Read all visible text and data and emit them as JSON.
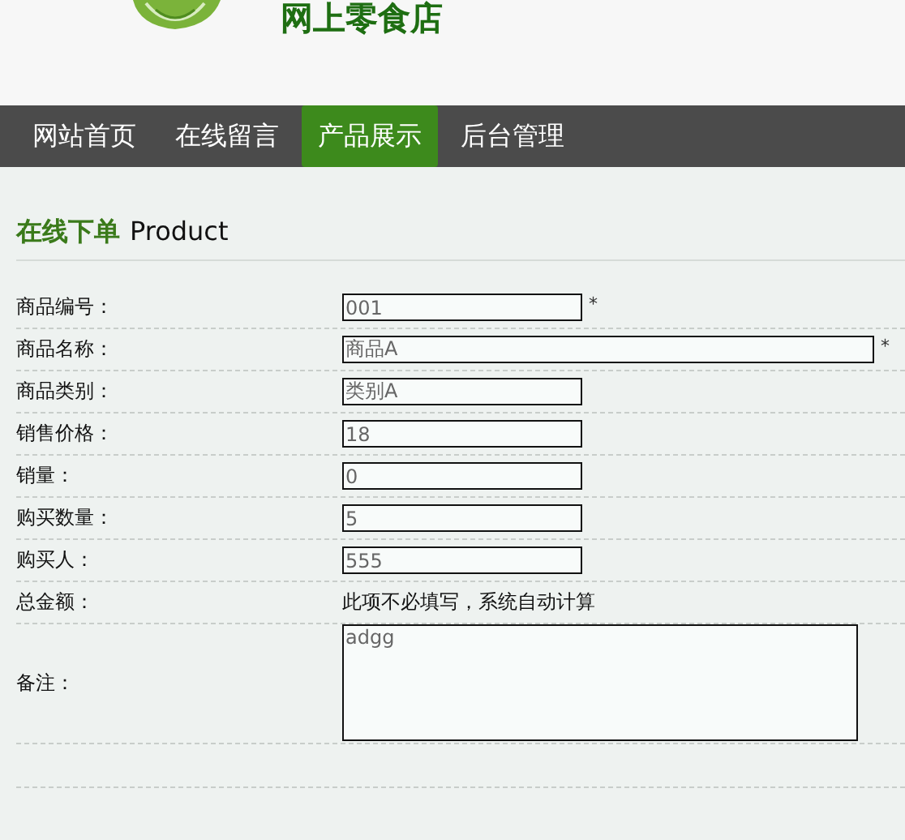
{
  "header": {
    "title": "网上零食店"
  },
  "nav": [
    {
      "label": "网站首页",
      "selected": false
    },
    {
      "label": "在线留言",
      "selected": false
    },
    {
      "label": "产品展示",
      "selected": true
    },
    {
      "label": "后台管理",
      "selected": false
    }
  ],
  "section": {
    "title": "在线下单",
    "subtitle": "Product"
  },
  "form": [
    {
      "kind": "short-input",
      "label": "商品编号：",
      "value": "001",
      "required_mark": "*"
    },
    {
      "kind": "long-input",
      "label": "商品名称：",
      "value": "商品A",
      "required_mark": "*"
    },
    {
      "kind": "short-input",
      "label": "商品类别：",
      "value": "类别A"
    },
    {
      "kind": "short-input",
      "label": "销售价格：",
      "value": "18"
    },
    {
      "kind": "short-input",
      "label": "销量：",
      "value": "0"
    },
    {
      "kind": "short-input",
      "label": "购买数量：",
      "value": "5"
    },
    {
      "kind": "short-input",
      "label": "购买人：",
      "value": "555"
    },
    {
      "kind": "note",
      "label": "总金额：",
      "value": "此项不必填写，系统自动计算"
    },
    {
      "kind": "textarea",
      "label": "备注：",
      "value": "adgg"
    }
  ]
}
